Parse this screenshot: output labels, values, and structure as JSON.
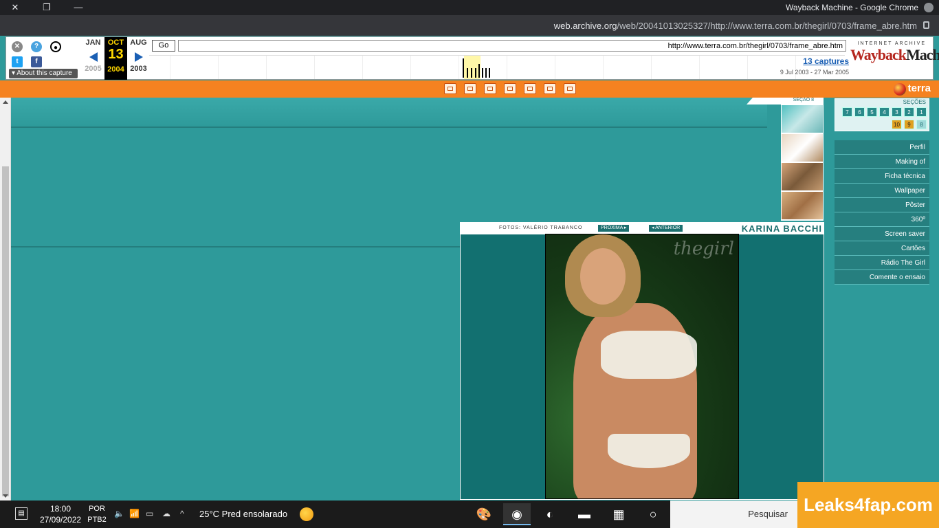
{
  "window": {
    "title": "Wayback Machine - Google Chrome",
    "url_prefix": "web.archive.org",
    "url_rest": "/web/20041013025327/http://www.terra.com.br/thegirl/0703/frame_abre.htm"
  },
  "wayback": {
    "logo_top": "INTERNET ARCHIVE",
    "logo_main_1": "Wayback",
    "logo_main_2": "Machine",
    "url_value": "http://www.terra.com.br/thegirl/0703/frame_abre.htm",
    "go_label": "Go",
    "captures_link": "13 captures",
    "date_range": "9 Jul 2003 - 27 Mar 2005",
    "months": {
      "prev": {
        "month": "AUG",
        "year": "2003"
      },
      "current": {
        "month": "OCT",
        "day": "13",
        "year": "2004"
      },
      "next": {
        "month": "JAN",
        "year": "2005"
      }
    },
    "about_label": "▾ About this capture"
  },
  "secoes": {
    "title": "SEÇÕES",
    "numbers_row1": [
      "1",
      "2",
      "3",
      "4",
      "5",
      "6",
      "7"
    ],
    "numbers_row2": [
      "8",
      "9",
      "10"
    ],
    "secao_label": "SEÇÃO 8"
  },
  "menu": [
    "Perfil",
    "Making of",
    "Ficha técnica",
    "Wallpaper",
    "Pôster",
    "360º",
    "Screen saver",
    "Cartões",
    "Rádio The Girl",
    "Comente o ensaio"
  ],
  "panel": {
    "name": "KARINA BACCHI",
    "prev_label": "◂ ANTERIOR",
    "next_label": "PRÓXIMA ▸",
    "credit": "FOTOS: VALÉRIO TRABANCO",
    "photo_watermark": "thegirl"
  },
  "terra": {
    "logo": "terra"
  },
  "taskbar": {
    "search_placeholder": "Pesquisar",
    "weather": "25°C  Pred ensolarado",
    "lang_line1": "POR",
    "lang_line2": "PTB2",
    "time": "18:00",
    "date": "27/09/2022"
  },
  "watermark": "Leaks4fap.com"
}
